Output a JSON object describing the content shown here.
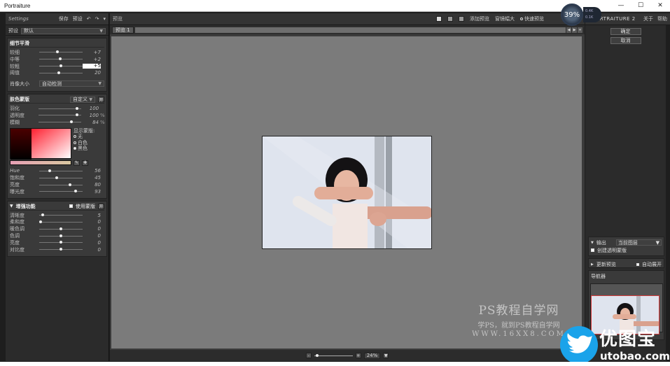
{
  "window": {
    "title": "Portraiture",
    "minimize": "—",
    "maximize": "☐",
    "close": "✕"
  },
  "left_top": {
    "settings": "Settings",
    "save": "保存",
    "preset": "预设",
    "undo": "↶",
    "redo": "↷",
    "menu": "▾"
  },
  "preset_row": {
    "label": "预设",
    "value": "默认"
  },
  "detail_smoothing": {
    "title": "细节平滑",
    "sliders": [
      {
        "label": "较细",
        "value": "+7",
        "pos": 0.42
      },
      {
        "label": "中等",
        "value": "+2",
        "pos": 0.48
      },
      {
        "label": "较粗",
        "value": "+5",
        "pos": 0.5,
        "boxed": true
      },
      {
        "label": "阈值",
        "value": "20",
        "pos": 0.45
      }
    ],
    "size_label": "肖像大小",
    "size_value": "自动检测"
  },
  "skin_mask": {
    "title": "肤色蒙版",
    "mode": "自定义",
    "toggle": "开",
    "sliders": [
      {
        "label": "羽化",
        "value": "100",
        "unit": "",
        "pos": 0.92
      },
      {
        "label": "透明度",
        "value": "100",
        "unit": "%",
        "pos": 0.92
      },
      {
        "label": "模糊",
        "value": "84",
        "unit": "%",
        "pos": 0.78
      }
    ],
    "mask_title": "显示蒙版:",
    "mask_options": [
      {
        "label": "无",
        "on": false
      },
      {
        "label": "白色",
        "on": false
      },
      {
        "label": "黑色",
        "on": true
      }
    ],
    "hsl_sliders": [
      {
        "label": "Hue",
        "value": "56",
        "pos": 0.22
      },
      {
        "label": "饱和度",
        "value": "45",
        "pos": 0.4
      },
      {
        "label": "亮度",
        "value": "80",
        "pos": 0.72
      },
      {
        "label": "曝光度",
        "value": "93",
        "pos": 0.86
      }
    ]
  },
  "enhance": {
    "title": "增强功能",
    "use_mask_label": "使用蒙版",
    "toggle": "开",
    "sliders": [
      {
        "label": "清晰度",
        "value": "5",
        "pos": 0.06
      },
      {
        "label": "柔和度",
        "value": "0",
        "pos": 0.0
      },
      {
        "label": "暖色调",
        "value": "0",
        "pos": 0.5
      },
      {
        "label": "色调",
        "value": "0",
        "pos": 0.5
      },
      {
        "label": "亮度",
        "value": "0",
        "pos": 0.5
      },
      {
        "label": "对比度",
        "value": "0",
        "pos": 0.5
      }
    ]
  },
  "center_top": {
    "preview": "预览",
    "add_preview": "添加预览",
    "fit": "窗镜幅大",
    "quick_preview": "快速预览"
  },
  "tab": {
    "label": "预览 1"
  },
  "watermark": {
    "line1": "PS教程自学网",
    "line2": "学PS，就到PS教程自学网",
    "line3": "WWW.16XX8.COM"
  },
  "zoom": {
    "value": "24%",
    "minus": "-",
    "plus": "+"
  },
  "brand": {
    "name": "PORTRAITURE 2",
    "about": "关于",
    "help": "帮助"
  },
  "gauge": {
    "value": "39%",
    "side_top": "0.4K",
    "side_bottom": "0.1K"
  },
  "right_top": {
    "ok": "确定",
    "cancel": "取消"
  },
  "output": {
    "title": "输出",
    "value": "当前图层",
    "checkbox": "创建透明蒙版"
  },
  "refresh": {
    "title": "更新预览",
    "auto": "自动展开"
  },
  "navigator": {
    "title": "导航器"
  },
  "logo": {
    "main": "优图宝",
    "sub": "utobao.com"
  }
}
